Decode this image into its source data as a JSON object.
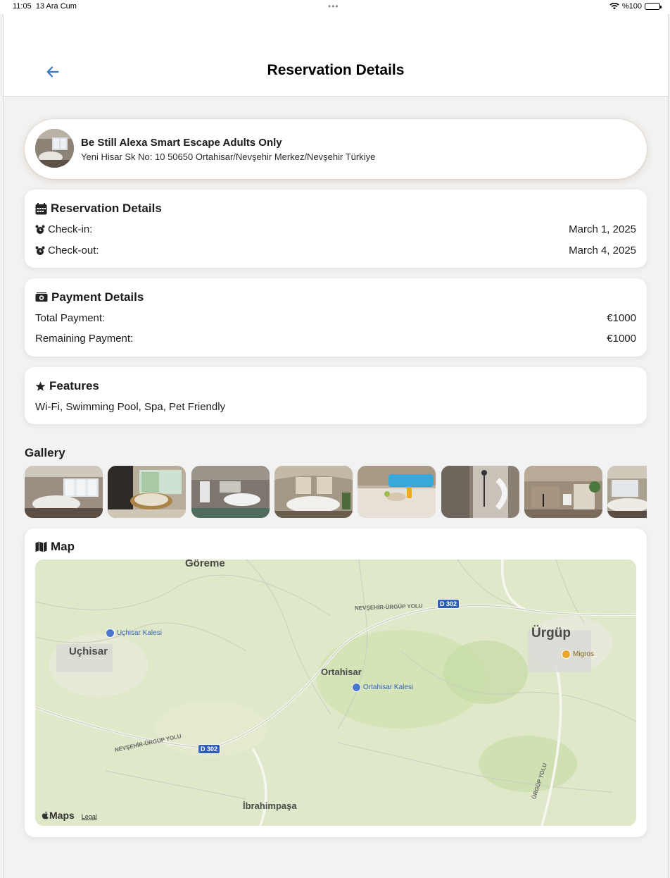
{
  "status_bar": {
    "time": "11:05",
    "date": "13 Ara Cum",
    "battery": "%100"
  },
  "nav": {
    "title": "Reservation Details",
    "back_icon": "arrow-left-icon"
  },
  "hotel": {
    "name": "Be Still Alexa Smart Escape Adults Only",
    "address": "Yeni Hisar Sk No: 10 50650 Ortahisar/Nevşehir Merkez/Nevşehir Türkiye"
  },
  "reservation": {
    "title": "Reservation Details",
    "icon": "calendar-icon",
    "checkin_label": "Check-in:",
    "checkin_value": "March 1, 2025",
    "checkout_label": "Check-out:",
    "checkout_value": "March 4, 2025",
    "row_icon": "alarm-clock-icon"
  },
  "payment": {
    "title": "Payment Details",
    "icon": "money-bill-icon",
    "total_label": "Total Payment:",
    "total_value": "€1000",
    "remaining_label": "Remaining Payment:",
    "remaining_value": "€1000"
  },
  "features": {
    "title": "Features",
    "icon": "star-icon",
    "list": "Wi-Fi, Swimming Pool, Spa, Pet Friendly"
  },
  "gallery": {
    "title": "Gallery",
    "photos": [
      "bedroom-1",
      "bedroom-pool",
      "bedroom-wide",
      "bedroom-2",
      "pool-terrace",
      "shower",
      "bathroom",
      "bedroom-3"
    ]
  },
  "map": {
    "title": "Map",
    "icon": "map-icon",
    "labels": {
      "goreme": "Göreme",
      "uchisar": "Uçhisar",
      "uchisar_kalesi": "Uçhisar Kalesi",
      "ortahisar": "Ortahisar",
      "ortahisar_kalesi": "Ortahisar Kalesi",
      "urgup": "Ürgüp",
      "migros": "Migros",
      "ibrahimpasa": "İbrahimpaşa",
      "road_top": "NEVŞEHİR-ÜRGÜP YOLU",
      "road_bottom": "NEVŞEHİR-ÜRGÜP YOLU",
      "road_right": "ÜRGÜP YOLU",
      "d302_top": "D 302",
      "d302_bottom": "D 302"
    },
    "attribution": "Maps",
    "legal": "Legal"
  },
  "colors": {
    "accent": "#3478c6",
    "background": "#f2f2f2",
    "card": "#ffffff",
    "map_land": "#dfe8c8"
  }
}
